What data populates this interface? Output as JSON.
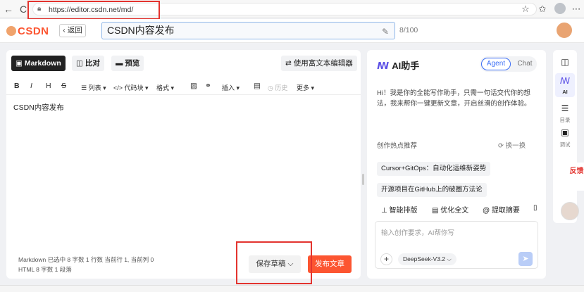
{
  "browser": {
    "url": "https://editor.csdn.net/md/",
    "back_icon": "←",
    "reload_icon": "C"
  },
  "header": {
    "logo": "CSDN",
    "back_label": "返回",
    "title_value": "CSDN内容发布",
    "counter": "8/100"
  },
  "editor": {
    "tabs": {
      "markdown": "Markdown",
      "compare": "比对",
      "preview": "预览"
    },
    "rich_editor": "使用富文本编辑器",
    "toolbar": {
      "bold": "B",
      "italic": "I",
      "heading": "H",
      "strike": "S",
      "list": "列表",
      "code": "代码块",
      "format": "格式",
      "insert": "插入",
      "history": "历史",
      "more": "更多"
    },
    "content": "CSDN内容发布",
    "status_line1": "Markdown 已选中   8 字数   1 行数   当前行 1, 当前列 0",
    "status_line2": "HTML   8 字数   1 段落",
    "save_draft": "保存草稿",
    "publish": "发布文章"
  },
  "ai": {
    "title": "AI助手",
    "mode_agent": "Agent",
    "mode_chat": "Chat",
    "intro": "Hi！我是你的全能写作助手，只需一句话交代你的想法，我来帮你一键更新文章，开启丝滑的创作体验。",
    "hot_label": "创作热点推荐",
    "refresh": "换一换",
    "topics": [
      "Cursor+GitOps：自动化运维新姿势",
      "开源项目在GitHub上的破圈方法论"
    ],
    "actions": {
      "layout": "智能排版",
      "optimize": "优化全文",
      "summary": "提取摘要"
    },
    "placeholder": "输入创作要求，AI帮你写",
    "model": "DeepSeek-V3.2"
  },
  "rail": {
    "ai_label": "AI",
    "toc_label": "目录",
    "debug_label": "调试",
    "feedback": "反馈"
  },
  "colors": {
    "brand": "#fc5531",
    "accent": "#3b6ef6",
    "highlight": "#e3342f"
  }
}
